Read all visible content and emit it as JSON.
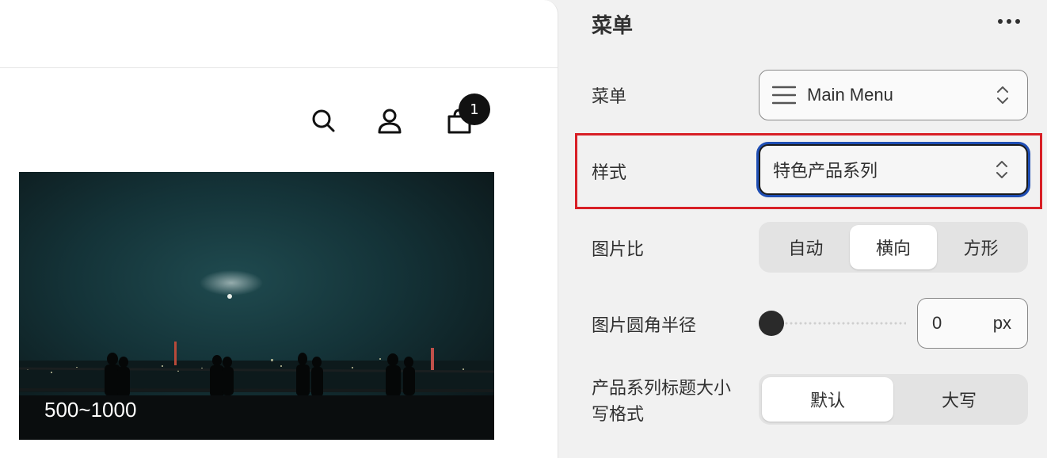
{
  "preview": {
    "cart_count": "1",
    "hero_caption": "500~1000",
    "icons": [
      "search-icon",
      "account-icon",
      "cart-icon"
    ]
  },
  "panel": {
    "title": "菜单",
    "more_icon": "more-horizontal-icon",
    "menu": {
      "label": "菜单",
      "value": "Main Menu"
    },
    "style": {
      "label": "样式",
      "value": "特色产品系列"
    },
    "image_ratio": {
      "label": "图片比",
      "options": [
        "自动",
        "横向",
        "方形"
      ],
      "selected": "横向"
    },
    "corner_radius": {
      "label": "图片圆角半径",
      "value": "0",
      "unit": "px",
      "slider_fraction": 0
    },
    "title_case": {
      "label_line1": "产品系列标题大小",
      "label_line2": "写格式",
      "options": [
        "默认",
        "大写"
      ],
      "selected": "默认"
    }
  },
  "colors": {
    "highlight_border": "#d81f26",
    "focus_ring": "#1f4eb4",
    "panel_bg": "#f1f1f1"
  }
}
